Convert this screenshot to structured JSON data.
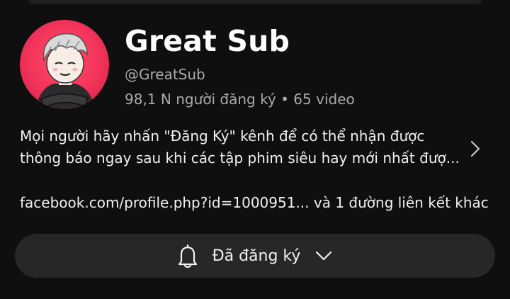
{
  "channel": {
    "name": "Great Sub",
    "handle": "@GreatSub",
    "stats": "98,1 N người đăng ký • 65 video",
    "description_lines": [
      "Mọi người hãy nhấn \"Đăng Ký\" kênh để có thể nhận được",
      "thông báo ngay sau khi các tập phim siêu hay mới nhất đượ..."
    ],
    "links": "facebook.com/profile.php?id=1000951... và 1 đường liên kết khác",
    "avatar_icon": "cartoon-character-avatar"
  },
  "subscribe": {
    "label": "Đã đăng ký",
    "bell_icon": "bell-icon",
    "dropdown_icon": "chevron-down-icon"
  },
  "colors": {
    "background": "#0f0f0f",
    "button": "#272727",
    "secondary_text": "#aaaaaa",
    "avatar_bg": "#f2335a"
  }
}
